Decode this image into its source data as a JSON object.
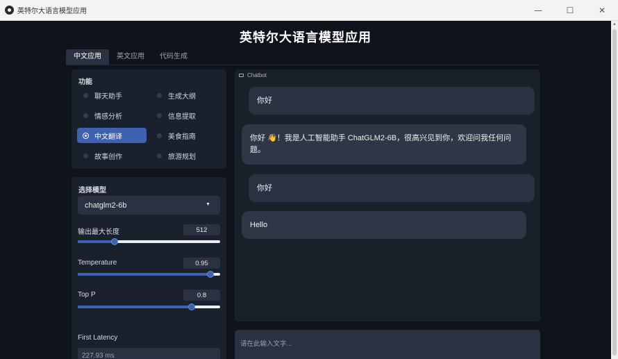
{
  "window": {
    "title": "英特尔大语言模型应用",
    "controls": {
      "minimize": "—",
      "maximize": "☐",
      "close": "✕"
    }
  },
  "app": {
    "title": "英特尔大语言模型应用",
    "tabs": [
      {
        "label": "中文应用",
        "active": true
      },
      {
        "label": "英文应用",
        "active": false
      },
      {
        "label": "代码生成",
        "active": false
      }
    ]
  },
  "function_panel": {
    "label": "功能",
    "options": [
      {
        "label": "聊天助手",
        "checked": false
      },
      {
        "label": "生成大纲",
        "checked": false
      },
      {
        "label": "情感分析",
        "checked": false
      },
      {
        "label": "信息提取",
        "checked": false
      },
      {
        "label": "中文翻译",
        "checked": true
      },
      {
        "label": "美食指南",
        "checked": false
      },
      {
        "label": "故事创作",
        "checked": false
      },
      {
        "label": "旅游规划",
        "checked": false
      }
    ]
  },
  "params_panel": {
    "model_label": "选择模型",
    "model_value": "chatglm2-6b",
    "sliders": [
      {
        "label": "输出最大长度",
        "value": "512",
        "fraction": 0.26
      },
      {
        "label": "Temperature",
        "value": "0.95",
        "fraction": 0.93
      },
      {
        "label": "Top P",
        "value": "0.8",
        "fraction": 0.8
      }
    ]
  },
  "latency_panel": {
    "label": "First Latency",
    "value": "227.93 ms"
  },
  "chat": {
    "label": "Chatbot",
    "messages": [
      {
        "role": "user",
        "text": "你好"
      },
      {
        "role": "bot",
        "text": "你好 👋！我是人工智能助手 ChatGLM2-6B，很高兴见到你，欢迎问我任何问题。"
      },
      {
        "role": "user",
        "text": "你好"
      },
      {
        "role": "bot",
        "text": "Hello"
      }
    ]
  },
  "input": {
    "placeholder": "请在此输入文字..."
  },
  "colors": {
    "background": "#0f131b",
    "panel": "#1b212c",
    "accent": "#3f62b0",
    "bubble_user": "#2a3140",
    "bubble_bot": "#2f3746"
  }
}
